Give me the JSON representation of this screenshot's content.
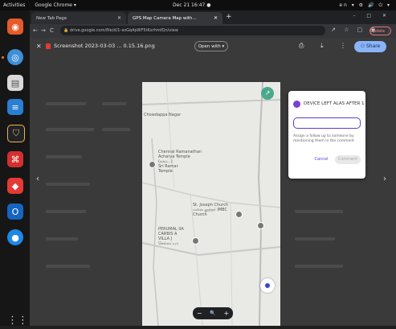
{
  "topbar": {
    "activities": "Activities",
    "app_name": "Google Chrome ▾",
    "clock": "Dec 21  16:47 ●",
    "tray": "en ▾  ⚙ 🔊 ⏻ ▾"
  },
  "dock": {
    "items": [
      "firefox-icon",
      "chrome-icon",
      "files-icon",
      "writer-icon",
      "shield-icon",
      "pdf-icon",
      "anydesk-icon",
      "outlook-icon",
      "zoom-icon"
    ],
    "apps_grid": "⋮⋮⋮"
  },
  "tabs": [
    {
      "label": "New Tab Page",
      "close": "✕"
    },
    {
      "label": "GPS Map Camera Map with...",
      "close": "✕"
    }
  ],
  "new_tab": "+",
  "window_controls": "– □ ✕",
  "toolbar": {
    "back": "←",
    "forward": "→",
    "reload": "C",
    "url": "drive.google.com/file/d/1-xoGq4pWF5tKxrhmfQn/view",
    "right_icons": "↗ ☆ ▢ ◉",
    "profile": "Update ⋮"
  },
  "viewer": {
    "close": "✕",
    "filename": "Screenshot 2023-03-03 ... 0.15.16.png",
    "open_with": "Open with ▾",
    "icons": "⎙ ⤓ ⋮",
    "share": "⚇ Share",
    "prev": "‹",
    "next": "›"
  },
  "map": {
    "labels": [
      "Chowdappa Nagar",
      "Chennai Ramanathan\nAcharya Temple\n(நகர...)\nSri Ramar\nTemple",
      "St. Joseph Church\nமலை லுத்தர் IMBC\nChurch",
      "PERUMAL IIA\nCARBIS A\nVILLA J\nசெல்லப்பா"
    ],
    "corner_icon": "↗"
  },
  "zoom": {
    "minus": "−",
    "mag": "🔍",
    "plus": "+"
  },
  "dialog": {
    "title": "DEVICE LEFT ALAS AFTER 1",
    "hint": "Assign a follow up to someone by mentioning them in the comment",
    "cancel": "Cancel",
    "comment": "Comment"
  }
}
